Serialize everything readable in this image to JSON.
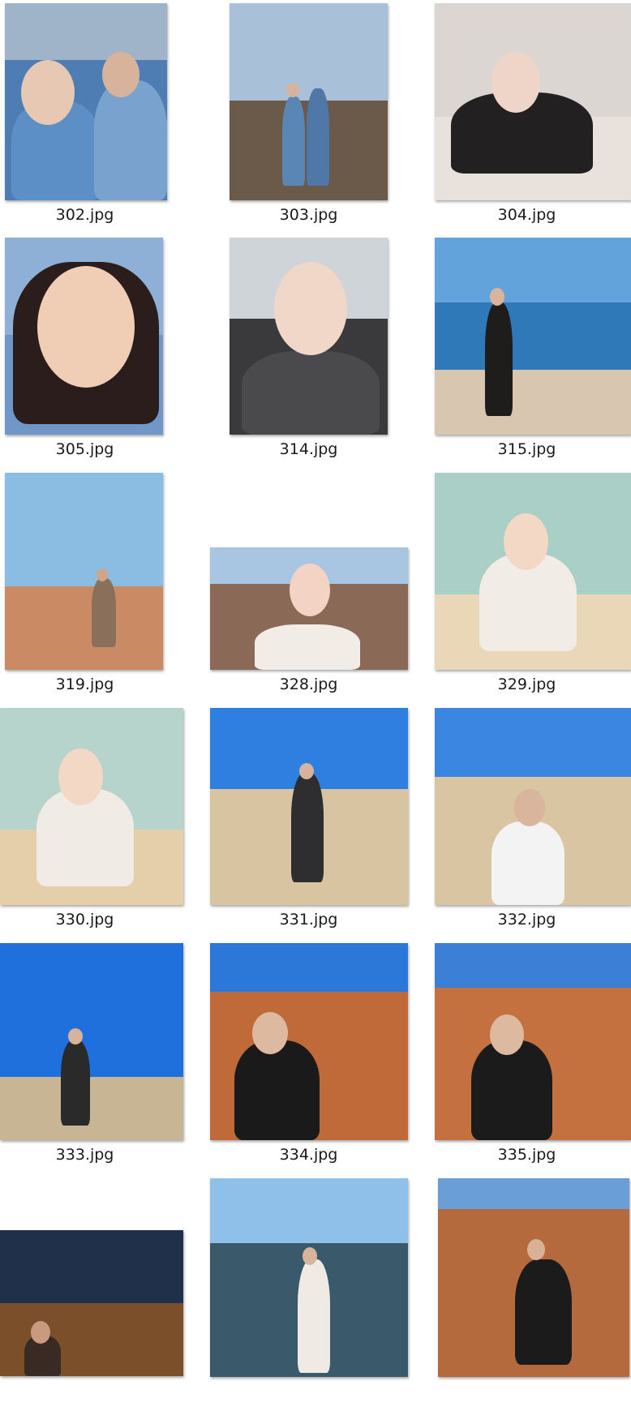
{
  "files": [
    {
      "name": "302.jpg",
      "sky": "#9fb3c9",
      "ground": "#4d7db3",
      "figure": "#5b8fc5",
      "head": "#e7c8b2"
    },
    {
      "name": "303.jpg",
      "sky": "#a9c1d8",
      "ground": "#6b5a4a",
      "figure": "#5a86b5",
      "head": "#d6b39a"
    },
    {
      "name": "304.jpg",
      "sky": "#dcd6d2",
      "ground": "#e9e2dc",
      "figure": "#232021",
      "head": "#efd5c8"
    },
    {
      "name": "305.jpg",
      "sky": "#8fb0d6",
      "ground": "#6f98c8",
      "figure": "#2a1d1b",
      "head": "#f0cdb5"
    },
    {
      "name": "314.jpg",
      "sky": "#cfd4d8",
      "ground": "#3a3a3c",
      "figure": "#4a4a4c",
      "head": "#f1d7c8"
    },
    {
      "name": "315.jpg",
      "sky": "#62a3dc",
      "ground": "#2f79b8",
      "figure": "#1f1c1c",
      "head": "#d9b49c"
    },
    {
      "name": "319.jpg",
      "sky": "#8bbde3",
      "ground": "#c98a64",
      "figure": "#8a6f5b",
      "head": "#d1a48a"
    },
    {
      "name": "328.jpg",
      "sky": "#a8c6e2",
      "ground": "#8a6a56",
      "figure": "#f2ece6",
      "head": "#f2d3c4"
    },
    {
      "name": "329.jpg",
      "sky": "#a9cfc6",
      "ground": "#e9d7b8",
      "figure": "#f1ede6",
      "head": "#f3d8c6"
    },
    {
      "name": "330.jpg",
      "sky": "#b7d4cc",
      "ground": "#e4cfaa",
      "figure": "#f0ebe4",
      "head": "#f3d8c6"
    },
    {
      "name": "331.jpg",
      "sky": "#2f7fe0",
      "ground": "#d8c4a0",
      "figure": "#2e2e30",
      "head": "#d6b39a"
    },
    {
      "name": "332.jpg",
      "sky": "#3a86e0",
      "ground": "#d9c5a2",
      "figure": "#f3f3f3",
      "head": "#d8b59c"
    },
    {
      "name": "333.jpg",
      "sky": "#1f6fdc",
      "ground": "#c8b593",
      "figure": "#2a2a2b",
      "head": "#d6b39a"
    },
    {
      "name": "334.jpg",
      "sky": "#2c78d8",
      "ground": "#c06a3a",
      "figure": "#1b1a1a",
      "head": "#ddb9a0"
    },
    {
      "name": "335.jpg",
      "sky": "#3b80d6",
      "ground": "#c4703f",
      "figure": "#1c1b1b",
      "head": "#ddb9a0"
    },
    {
      "name": "",
      "sky": "#20304a",
      "ground": "#7a4f2a",
      "figure": "#3a2a24",
      "head": "#c99a7e"
    },
    {
      "name": "",
      "sky": "#8fc0ea",
      "ground": "#3a5a6c",
      "figure": "#efeae4",
      "head": "#d9b49c"
    },
    {
      "name": "",
      "sky": "#6a9ed6",
      "ground": "#b46a3c",
      "figure": "#1c1b1b",
      "head": "#d8b197"
    }
  ]
}
